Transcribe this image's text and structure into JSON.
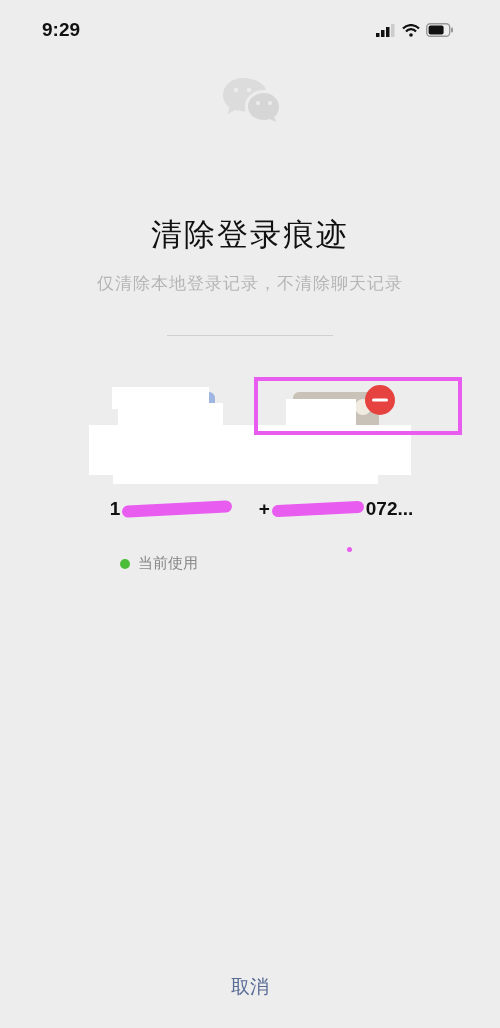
{
  "status_bar": {
    "time": "9:29"
  },
  "title": "清除登录痕迹",
  "subtitle": "仅清除本地登录记录，不清除聊天记录",
  "accounts": [
    {
      "name_parts": [
        "1"
      ],
      "current": true,
      "status": "当前使用",
      "removable": false
    },
    {
      "name_parts": [
        "+",
        "072..."
      ],
      "current": false,
      "removable": true
    }
  ],
  "cancel_button": "取消"
}
